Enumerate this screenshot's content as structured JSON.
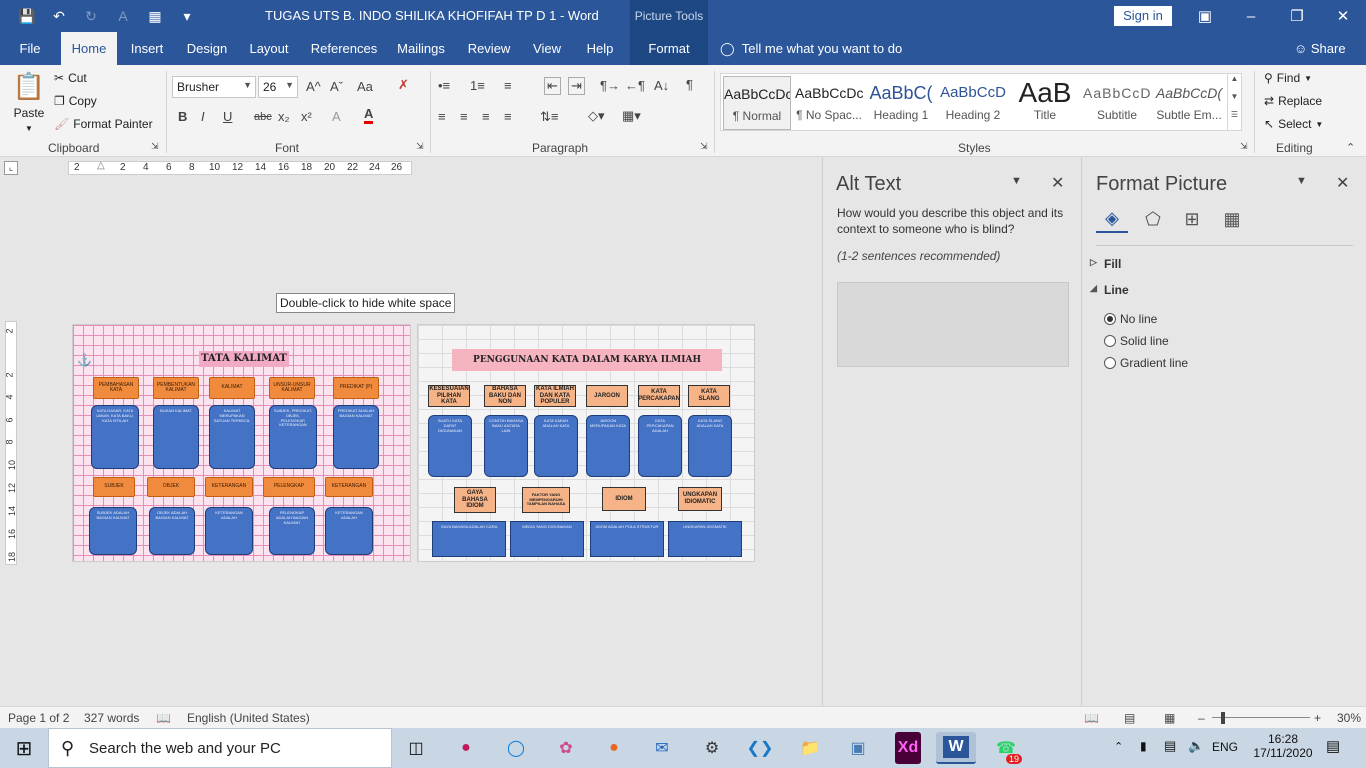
{
  "window": {
    "doc_title": "TUGAS UTS B. INDO SHILIKA KHOFIFAH TP D 1  -  Word",
    "context_group": "Picture Tools",
    "sign_in": "Sign in"
  },
  "tabs": {
    "file": "File",
    "home": "Home",
    "insert": "Insert",
    "design": "Design",
    "layout": "Layout",
    "references": "References",
    "mailings": "Mailings",
    "review": "Review",
    "view": "View",
    "help": "Help",
    "format": "Format",
    "tell_me": "Tell me what you want to do",
    "share": "Share"
  },
  "clipboard": {
    "paste": "Paste",
    "cut": "Cut",
    "copy": "Copy",
    "format_painter": "Format Painter",
    "label": "Clipboard"
  },
  "font": {
    "name": "Brusher",
    "size": "26",
    "label": "Font",
    "bold": "B",
    "italic": "I",
    "underline": "U",
    "strike": "abc",
    "sub": "x₂",
    "sup": "x²",
    "grow": "A^",
    "shrink": "Aˇ",
    "case": "Aa",
    "effects": "A",
    "color": "A",
    "accent_color": "#e00000"
  },
  "paragraph": {
    "label": "Paragraph"
  },
  "styles": {
    "label": "Styles",
    "items": [
      {
        "preview": "AaBbCcDc",
        "name": "¶ Normal"
      },
      {
        "preview": "AaBbCcDc",
        "name": "¶ No Spac..."
      },
      {
        "preview": "AaBbC(",
        "name": "Heading 1"
      },
      {
        "preview": "AaBbCcD",
        "name": "Heading 2"
      },
      {
        "preview": "AaB",
        "name": "Title"
      },
      {
        "preview": "AaBbCcD",
        "name": "Subtitle"
      },
      {
        "preview": "AaBbCcD(",
        "name": "Subtle Em..."
      }
    ]
  },
  "editing": {
    "label": "Editing",
    "find": "Find",
    "replace": "Replace",
    "select": "Select"
  },
  "ruler": {
    "top": [
      "2",
      "2",
      "4",
      "6",
      "8",
      "10",
      "12",
      "14",
      "16",
      "18",
      "20",
      "22",
      "24",
      "26"
    ],
    "left": [
      "2",
      "2",
      "4",
      "6",
      "8",
      "10",
      "12",
      "14",
      "16",
      "18"
    ]
  },
  "tooltip": "Double-click to hide white space",
  "page1": {
    "title": "TATA KALIMAT",
    "headers": [
      "PEMBAHASAN KATA",
      "PEMBENTUKAN KALIMAT",
      "KALIMAT",
      "UNSUR-UNSUR KALIMAT",
      "PREDIKAT (P)"
    ],
    "mid_headers": [
      "SUBJEK",
      "OBJEK",
      "KETERANGAN",
      "PELENGKAP",
      "KETERANGAN"
    ],
    "top_texts": [
      "KATA DASAR, KATA UMUM, KATA BAKU, KATA ISTILAH",
      "BUKAN KALIMAT",
      "KALIMAT MERUPAKAN SATUAN TERKECIL",
      "SUBJEK, PREDIKAT, OBJEK, PELENGKAP, KETERANGAN",
      "PREDIKAT ADALAH BAGIAN KALIMAT"
    ],
    "bottom_texts": [
      "SUBJEK ADALAH BAGIAN KALIMAT",
      "OBJEK ADALAH BAGIAN KALIMAT",
      "KETERANGAN ADALAH",
      "PELENGKAP ADALAH BAGIAN KALIMAT",
      "KETERANGAN ADALAH"
    ]
  },
  "page2": {
    "title": "PENGGUNAAN KATA DALAM KARYA ILMIAH",
    "headers": [
      "KESESUAIAN PILIHAN KATA",
      "BAHASA BAKU DAN NON",
      "KATA ILMIAH DAN KATA POPULER",
      "JARGON",
      "KATA PERCAKAPAN",
      "KATA SLANG"
    ],
    "top_texts": [
      "SUATU KATA DAPAT DIGUNAKAN",
      "CONTOH BAHASA BAKU ANTARA LAIN",
      "KATA ILMIAH ADALAH KATA",
      "JARGON MERUPAKAN KATA",
      "KATA PERCAKAPAN ADALAH",
      "KATA SLANG ADALAH KATA"
    ],
    "sub_headers": [
      "GAYA BAHASA IDIOM",
      "FAKTOR YANG MEMPENGARUHI TAMPILAN BAHASA",
      "IDIOM",
      "UNGKAPAN IDIOMATIC"
    ],
    "bottom_texts": [
      "GAYA BAHASA ADALAH CARA",
      "MEDIA YANG DIGUNAKAN",
      "IDIOM ADALAH POLA STRUKTUR",
      "UNGKAPAN IDIOMATIK"
    ]
  },
  "alt_text": {
    "title": "Alt Text",
    "question": "How would you describe this object and its context to someone who is blind?",
    "recommended": "(1-2 sentences recommended)"
  },
  "format_picture": {
    "title": "Format Picture",
    "fill": "Fill",
    "line": "Line",
    "options": [
      "No line",
      "Solid line",
      "Gradient line"
    ],
    "selected": "No line"
  },
  "status": {
    "page": "Page 1 of 2",
    "words": "327 words",
    "language": "English (United States)",
    "zoom": "30%"
  },
  "taskbar": {
    "search": "Search the web and your PC",
    "lang": "ENG",
    "time": "16:28",
    "date": "17/11/2020",
    "badge": "19"
  }
}
